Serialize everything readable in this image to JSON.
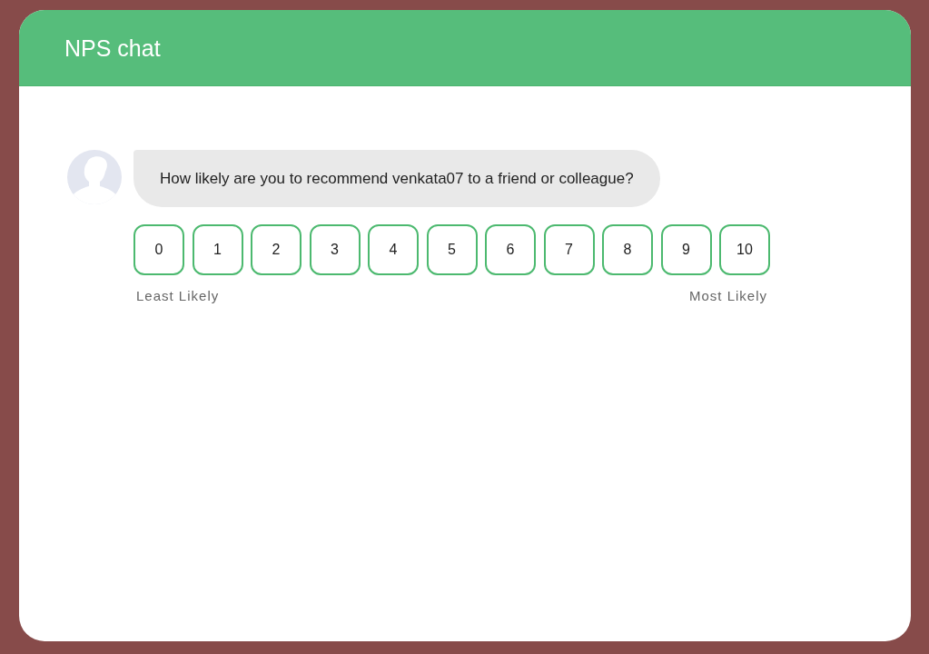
{
  "window": {
    "title": "NPS chat"
  },
  "message": {
    "text": "How likely are you to recommend venkata07 to a friend or colleague?"
  },
  "scale": {
    "options": [
      {
        "label": "0",
        "selected": false
      },
      {
        "label": "1",
        "selected": false
      },
      {
        "label": "2",
        "selected": false
      },
      {
        "label": "3",
        "selected": false
      },
      {
        "label": "4",
        "selected": false
      },
      {
        "label": "5",
        "selected": false
      },
      {
        "label": "6",
        "selected": false
      },
      {
        "label": "7",
        "selected": false
      },
      {
        "label": "8",
        "selected": false
      },
      {
        "label": "9",
        "selected": false
      },
      {
        "label": "10",
        "selected": false
      }
    ],
    "low_label": "Least Likely",
    "high_label": "Most Likely"
  }
}
